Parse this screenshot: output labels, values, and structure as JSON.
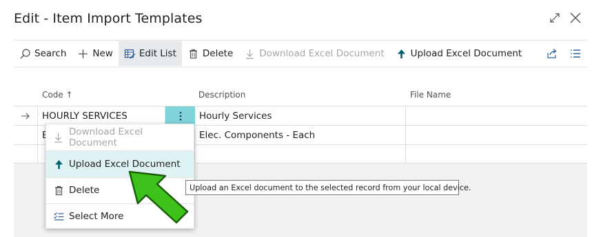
{
  "window": {
    "title": "Edit - Item Import Templates",
    "expand_icon": "expand-icon",
    "close_icon": "close-icon"
  },
  "toolbar": {
    "search_label": "Search",
    "new_label": "New",
    "edit_list_label": "Edit List",
    "delete_label": "Delete",
    "download_label": "Download Excel Document",
    "upload_label": "Upload Excel Document",
    "share_icon": "share-icon",
    "list_icon": "list-view-icon"
  },
  "table": {
    "columns": [
      "Code ↑",
      "Description",
      "File Name"
    ],
    "rows": [
      {
        "code": "HOURLY SERVICES",
        "description": "Hourly Services",
        "file_name": ""
      },
      {
        "code": "E",
        "description": "Elec. Components - Each",
        "file_name": ""
      },
      {
        "code": "",
        "description": "",
        "file_name": ""
      }
    ]
  },
  "context_menu": {
    "items": [
      {
        "label": "Download Excel Document",
        "icon": "download-icon",
        "state": "disabled"
      },
      {
        "label": "Upload Excel Document",
        "icon": "upload-icon",
        "state": "hover"
      },
      {
        "label": "Delete",
        "icon": "trash-icon",
        "state": "normal"
      },
      {
        "label": "Select More",
        "icon": "select-more-icon",
        "state": "normal"
      }
    ]
  },
  "tooltip": {
    "text": "Upload an Excel document to the selected record from your local device."
  },
  "colors": {
    "accent": "#7fd3d9",
    "upload_arrow": "#00606a",
    "pointer_arrow": "#3ec21b",
    "disabled_text": "#a6a6a6"
  }
}
